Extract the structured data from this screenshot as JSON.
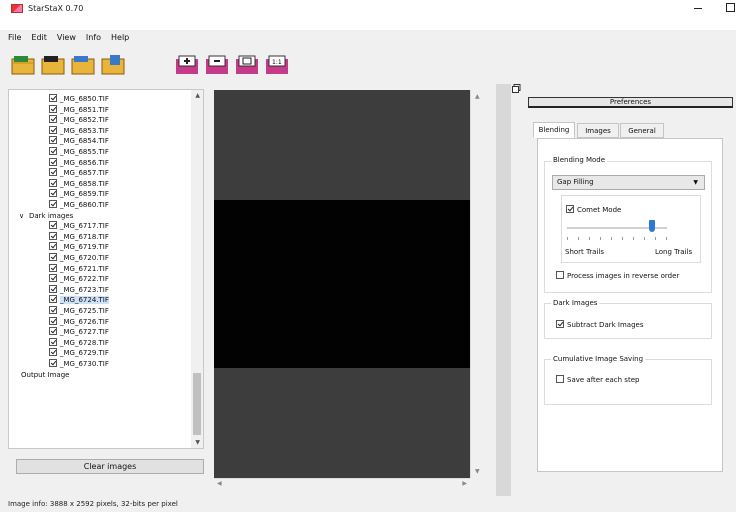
{
  "window": {
    "title": "StarStaX 0.70"
  },
  "menu": [
    "File",
    "Edit",
    "View",
    "Info",
    "Help"
  ],
  "toolbar": {
    "file_buttons": [
      "open-images-icon",
      "open-dark-icon",
      "save-icon",
      "export-icon"
    ],
    "zoom_buttons": [
      "zoom-in-icon",
      "zoom-out-icon",
      "fit-icon",
      "actual-size-icon"
    ]
  },
  "tree": {
    "files_top": [
      "_MG_6850.TIF",
      "_MG_6851.TIF",
      "_MG_6852.TIF",
      "_MG_6853.TIF",
      "_MG_6854.TIF",
      "_MG_6855.TIF",
      "_MG_6856.TIF",
      "_MG_6857.TIF",
      "_MG_6858.TIF",
      "_MG_6859.TIF",
      "_MG_6860.TIF"
    ],
    "dark_label": "Dark images",
    "dark_files": [
      "_MG_6717.TIF",
      "_MG_6718.TIF",
      "_MG_6719.TIF",
      "_MG_6720.TIF",
      "_MG_6721.TIF",
      "_MG_6722.TIF",
      "_MG_6723.TIF",
      "_MG_6724.TIF",
      "_MG_6725.TIF",
      "_MG_6726.TIF",
      "_MG_6727.TIF",
      "_MG_6728.TIF",
      "_MG_6729.TIF",
      "_MG_6730.TIF"
    ],
    "selected": "_MG_6724.TIF",
    "output_label": "Output Image"
  },
  "clear_images_label": "Clear images",
  "status": "Image info: 3888 x 2592 pixels, 32-bits per pixel",
  "preferences": {
    "header": "Preferences",
    "tabs": [
      "Blending",
      "Images",
      "General"
    ],
    "active_tab": "Blending",
    "blending_mode": {
      "title": "Blending Mode",
      "selected": "Gap Filling",
      "comet_mode_label": "Comet Mode",
      "comet_mode_checked": true,
      "slider_level": 0.85,
      "short_label": "Short Trails",
      "long_label": "Long Trails",
      "reverse_label": "Process images in reverse order",
      "reverse_checked": false
    },
    "dark_images": {
      "title": "Dark Images",
      "subtract_label": "Subtract Dark Images",
      "subtract_checked": true
    },
    "cumulative": {
      "title": "Cumulative Image Saving",
      "save_label": "Save after each step",
      "save_checked": false
    }
  },
  "colors": {
    "accent": "#2e78d4",
    "image_bg": "#3d3d3d",
    "image_band": "#020202"
  }
}
